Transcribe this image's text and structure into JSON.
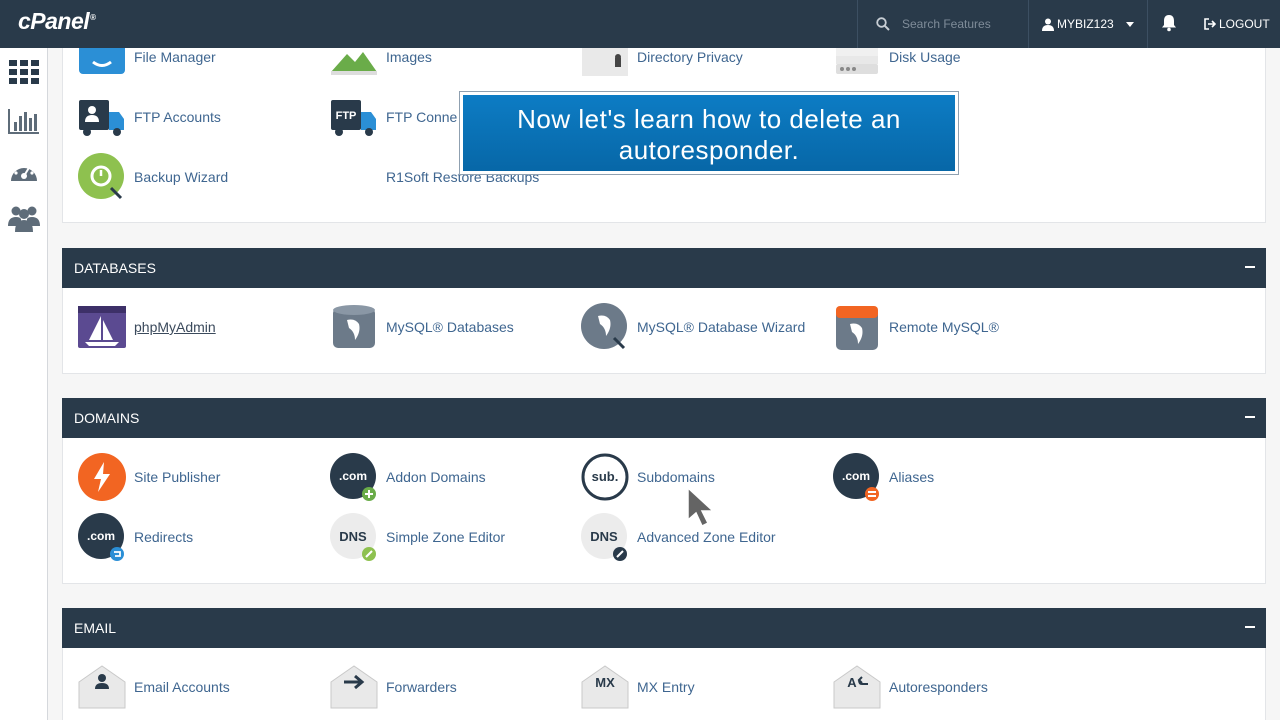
{
  "topbar": {
    "logo": "cPanel",
    "search_placeholder": "Search Features",
    "username": "MYBIZ123",
    "logout_label": "LOGOUT"
  },
  "sidebar": {
    "items": [
      "grid-icon",
      "stats-icon",
      "dashboard-gauge-icon",
      "users-icon"
    ]
  },
  "files_section": {
    "items": [
      "File Manager",
      "Images",
      "Directory Privacy",
      "Disk Usage",
      "FTP Accounts",
      "FTP Conne",
      "Backup Wizard",
      "R1Soft Restore Backups"
    ]
  },
  "banner": {
    "text": "Now let's learn how to delete an autoresponder."
  },
  "databases": {
    "title": "DATABASES",
    "items": [
      "phpMyAdmin",
      "MySQL® Databases",
      "MySQL® Database Wizard",
      "Remote MySQL®"
    ]
  },
  "domains": {
    "title": "DOMAINS",
    "items": [
      "Site Publisher",
      "Addon Domains",
      "Subdomains",
      "Aliases",
      "Redirects",
      "Simple Zone Editor",
      "Advanced Zone Editor"
    ]
  },
  "email": {
    "title": "EMAIL",
    "items": [
      "Email Accounts",
      "Forwarders",
      "MX Entry",
      "Autoresponders"
    ]
  },
  "colors": {
    "header_bg": "#293a4a",
    "link": "#3f6690",
    "banner": "#0b73b8"
  }
}
